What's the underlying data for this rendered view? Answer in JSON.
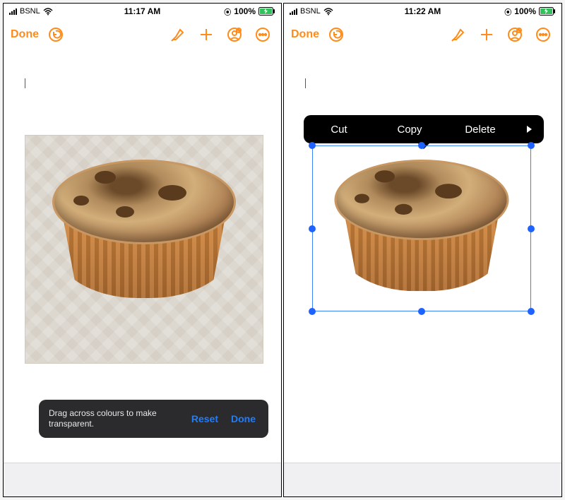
{
  "left": {
    "status": {
      "carrier": "BSNL",
      "time": "11:17 AM",
      "battery": "100%"
    },
    "toolbar": {
      "done_label": "Done"
    },
    "instant_alpha": {
      "hint": "Drag across colours to make transparent.",
      "reset_label": "Reset",
      "done_label": "Done"
    }
  },
  "right": {
    "status": {
      "carrier": "BSNL",
      "time": "11:22 AM",
      "battery": "100%"
    },
    "toolbar": {
      "done_label": "Done"
    },
    "context_menu": {
      "items": [
        "Cut",
        "Copy",
        "Delete"
      ]
    }
  }
}
